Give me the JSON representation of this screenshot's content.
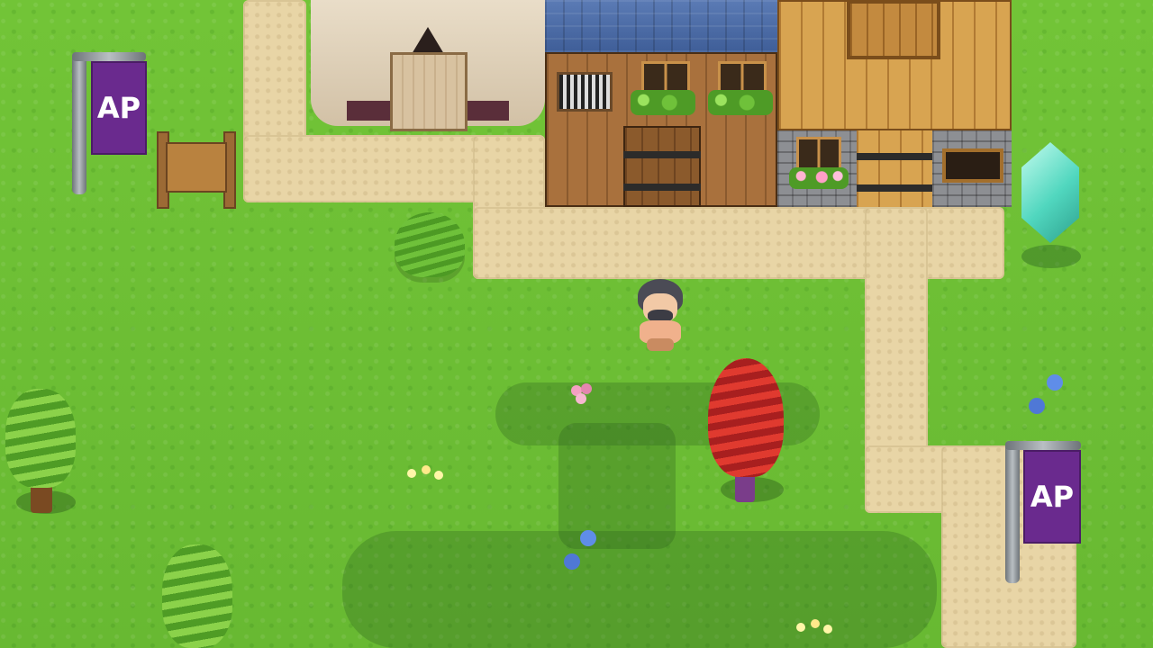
{
  "game": {
    "signs": [
      {
        "label": "AP"
      },
      {
        "label": "AP"
      }
    ]
  },
  "colors": {
    "grass": "#6cbd33",
    "path": "#e8d5a6",
    "banner": "#6a2a8e",
    "roof": "#4a69a8",
    "crystal": "#4fd8c6",
    "red_tree": "#c9302a"
  }
}
